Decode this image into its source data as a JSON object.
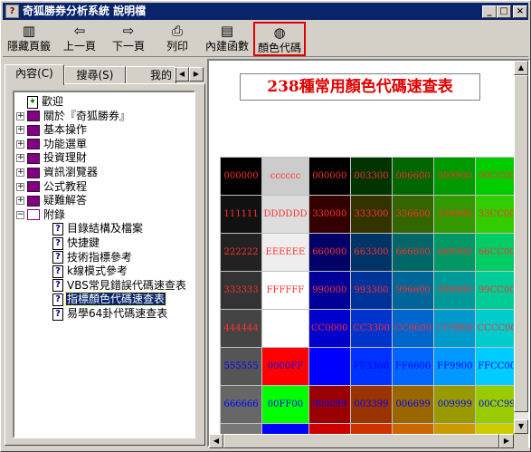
{
  "window": {
    "title": "奇狐勝券分析系統 說明檔",
    "app_icon": "help-book-icon",
    "min": "_",
    "max": "□",
    "close": "×"
  },
  "toolbar": [
    {
      "id": "hide",
      "label": "隱藏頁籤",
      "icon": "▥"
    },
    {
      "id": "back",
      "label": "上一頁",
      "icon": "⇦"
    },
    {
      "id": "forward",
      "label": "下一頁",
      "icon": "⇨"
    },
    {
      "id": "print",
      "label": "列印",
      "icon": "⎙"
    },
    {
      "id": "builtin",
      "label": "內建函數",
      "icon": "▤"
    },
    {
      "id": "colors",
      "label": "顏色代碼",
      "icon": "◍"
    }
  ],
  "tabs": [
    {
      "label": "內容(C)"
    },
    {
      "label": "搜尋(S)"
    },
    {
      "label": "我的"
    }
  ],
  "tab_arrows": {
    "left": "◀",
    "right": "▶"
  },
  "tree": [
    {
      "label": "歡迎",
      "type": "page",
      "level": 0
    },
    {
      "label": "關於『奇狐勝券』",
      "type": "book",
      "level": 0
    },
    {
      "label": "基本操作",
      "type": "book",
      "level": 0
    },
    {
      "label": "功能選單",
      "type": "book",
      "level": 0
    },
    {
      "label": "投資理財",
      "type": "book",
      "level": 0
    },
    {
      "label": "資訊瀏覽器",
      "type": "book",
      "level": 0
    },
    {
      "label": "公式教程",
      "type": "book",
      "level": 0
    },
    {
      "label": "疑難解答",
      "type": "book",
      "level": 0
    },
    {
      "label": "附錄",
      "type": "openbook",
      "level": 0
    },
    {
      "label": "目錄結構及檔案",
      "type": "q",
      "level": 1
    },
    {
      "label": "快捷鍵",
      "type": "q",
      "level": 1
    },
    {
      "label": "技術指標參考",
      "type": "q",
      "level": 1
    },
    {
      "label": "k線模式參考",
      "type": "q",
      "level": 1
    },
    {
      "label": "VBS常見錯誤代碼速查表",
      "type": "q",
      "level": 1
    },
    {
      "label": "指標顏色代碼速查表",
      "type": "q",
      "level": 1,
      "selected": true
    },
    {
      "label": "易學64卦代碼速查表",
      "type": "q",
      "level": 1
    }
  ],
  "content": {
    "heading": "238種常用顏色代碼速查表",
    "rows": [
      [
        {
          "t": "000000",
          "bg": "#000000",
          "fg": "#ff3030"
        },
        {
          "t": "cccccc",
          "bg": "#cccccc",
          "fg": "#ff3030"
        },
        {
          "t": "000000",
          "bg": "#000000",
          "fg": "#ff3030"
        },
        {
          "t": "003300",
          "bg": "#003300",
          "fg": "#ff3030"
        },
        {
          "t": "006600",
          "bg": "#006600",
          "fg": "#ff3030"
        },
        {
          "t": "009900",
          "bg": "#009900",
          "fg": "#ff3030"
        },
        {
          "t": "00CC00",
          "bg": "#00cc00",
          "fg": "#ff3030"
        }
      ],
      [
        {
          "t": "111111",
          "bg": "#111111",
          "fg": "#ff3030"
        },
        {
          "t": "DDDDDD",
          "bg": "#dddddd",
          "fg": "#ff3030"
        },
        {
          "t": "330000",
          "bg": "#330000",
          "fg": "#ff3030"
        },
        {
          "t": "333300",
          "bg": "#333300",
          "fg": "#ff3030"
        },
        {
          "t": "336600",
          "bg": "#336600",
          "fg": "#ff3030"
        },
        {
          "t": "339900",
          "bg": "#339900",
          "fg": "#ff3030"
        },
        {
          "t": "33CC00",
          "bg": "#33cc00",
          "fg": "#ff3030"
        }
      ],
      [
        {
          "t": "222222",
          "bg": "#222222",
          "fg": "#ff3030"
        },
        {
          "t": "EEEEEE",
          "bg": "#eeeeee",
          "fg": "#ff3030"
        },
        {
          "t": "660000",
          "bg": "#000066",
          "fg": "#ff3030"
        },
        {
          "t": "663300",
          "bg": "#003366",
          "fg": "#ff3030"
        },
        {
          "t": "666600",
          "bg": "#006666",
          "fg": "#ff3030"
        },
        {
          "t": "669900",
          "bg": "#009966",
          "fg": "#ff3030"
        },
        {
          "t": "66CC00",
          "bg": "#00cc66",
          "fg": "#ff3030"
        }
      ],
      [
        {
          "t": "333333",
          "bg": "#333333",
          "fg": "#ff3030"
        },
        {
          "t": "FFFFFF",
          "bg": "#ffffff",
          "fg": "#ff3030"
        },
        {
          "t": "990000",
          "bg": "#000099",
          "fg": "#ff3030"
        },
        {
          "t": "993300",
          "bg": "#003399",
          "fg": "#ff3030"
        },
        {
          "t": "996600",
          "bg": "#006699",
          "fg": "#ff3030"
        },
        {
          "t": "999900",
          "bg": "#009999",
          "fg": "#ff3030"
        },
        {
          "t": "99CC00",
          "bg": "#00cc99",
          "fg": "#ff3030"
        }
      ],
      [
        {
          "t": "444444",
          "bg": "#444444",
          "fg": "#ff3030"
        },
        {
          "t": "",
          "bg": "#ffffff",
          "fg": "#ff3030"
        },
        {
          "t": "CC0000",
          "bg": "#0000cc",
          "fg": "#ff3030"
        },
        {
          "t": "CC3300",
          "bg": "#0033cc",
          "fg": "#ff3030"
        },
        {
          "t": "CC6600",
          "bg": "#0066cc",
          "fg": "#ff3030"
        },
        {
          "t": "CC9900",
          "bg": "#0099cc",
          "fg": "#ff3030"
        },
        {
          "t": "CCCC00",
          "bg": "#00cccc",
          "fg": "#ff3030"
        }
      ],
      [
        {
          "t": "555555",
          "bg": "#555555",
          "fg": "#0000ff"
        },
        {
          "t": "0000FF",
          "bg": "#ff0000",
          "fg": "#0000ff"
        },
        {
          "t": "FF0000",
          "bg": "#0000ff",
          "fg": "#0000ff"
        },
        {
          "t": "FF3300",
          "bg": "#0033ff",
          "fg": "#0000ff"
        },
        {
          "t": "FF6600",
          "bg": "#0066ff",
          "fg": "#0000ff"
        },
        {
          "t": "FF9900",
          "bg": "#0099ff",
          "fg": "#0000ff"
        },
        {
          "t": "FFCC00",
          "bg": "#00ccff",
          "fg": "#0000ff"
        }
      ],
      [
        {
          "t": "666666",
          "bg": "#666666",
          "fg": "#0000ff"
        },
        {
          "t": "00FF00",
          "bg": "#00ff00",
          "fg": "#0000ff"
        },
        {
          "t": "000099",
          "bg": "#990000",
          "fg": "#0000ff"
        },
        {
          "t": "003399",
          "bg": "#993300",
          "fg": "#0000ff"
        },
        {
          "t": "006699",
          "bg": "#996600",
          "fg": "#0000ff"
        },
        {
          "t": "009999",
          "bg": "#999900",
          "fg": "#0000ff"
        },
        {
          "t": "00CC99",
          "bg": "#99cc00",
          "fg": "#0000ff"
        }
      ],
      [
        {
          "t": "",
          "bg": "#777777",
          "fg": "#0000ff"
        },
        {
          "t": "",
          "bg": "#0000ff",
          "fg": "#0000ff"
        },
        {
          "t": "",
          "bg": "#cc0000",
          "fg": "#0000ff"
        },
        {
          "t": "",
          "bg": "#cc3300",
          "fg": "#0000ff"
        },
        {
          "t": "",
          "bg": "#cc6600",
          "fg": "#0000ff"
        },
        {
          "t": "",
          "bg": "#cc9900",
          "fg": "#0000ff"
        },
        {
          "t": "",
          "bg": "#cccc00",
          "fg": "#0000ff"
        }
      ]
    ]
  },
  "scroll": {
    "up": "▲",
    "down": "▼",
    "left": "◀",
    "right": "▶"
  }
}
